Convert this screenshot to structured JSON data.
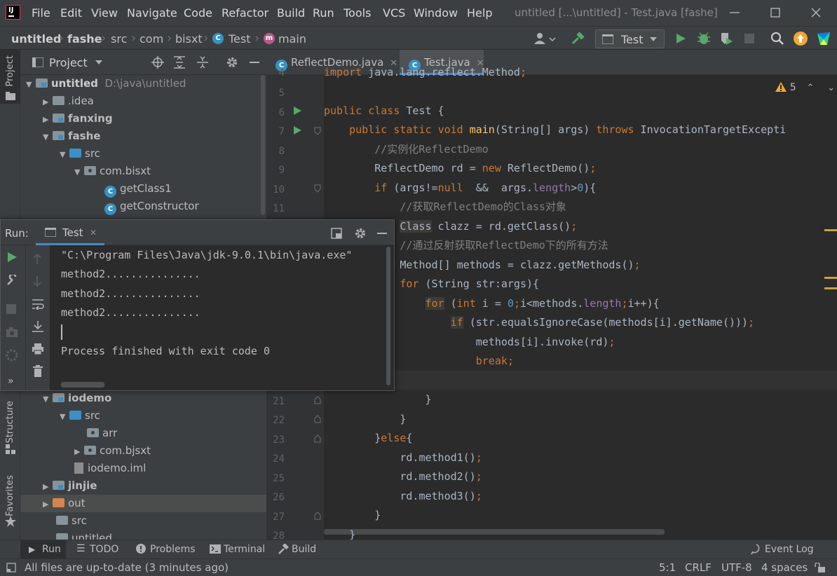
{
  "menubar": {
    "items": [
      "File",
      "Edit",
      "View",
      "Navigate",
      "Code",
      "Refactor",
      "Build",
      "Run",
      "Tools",
      "VCS",
      "Window",
      "Help"
    ],
    "window_title": "untitled [...\\untitled] - Test.java [fashe]"
  },
  "breadcrumb": {
    "items": [
      "untitled",
      "fashe",
      "src",
      "com",
      "bisxt",
      "Test",
      "main"
    ]
  },
  "run_config": {
    "label": "Test"
  },
  "side_labels": {
    "project": "Project",
    "structure": "Structure",
    "favorites": "Favorites"
  },
  "project_panel": {
    "title": "Project",
    "tree_top": [
      {
        "label": "untitled",
        "path": "D:\\java\\untitled"
      },
      {
        "label": ".idea"
      },
      {
        "label": "fanxing"
      },
      {
        "label": "fashe"
      },
      {
        "label": "src"
      },
      {
        "label": "com.bisxt"
      },
      {
        "label": "getClass1"
      },
      {
        "label": "getConstructor"
      }
    ],
    "tree_bottom": [
      {
        "label": "iodemo"
      },
      {
        "label": "src"
      },
      {
        "label": "arr"
      },
      {
        "label": "com.bjsxt"
      },
      {
        "label": "iodemo.iml"
      },
      {
        "label": "jinjie"
      },
      {
        "label": "out"
      },
      {
        "label": "src"
      },
      {
        "label": "untitled"
      }
    ]
  },
  "editor": {
    "tabs": [
      {
        "label": "ReflectDemo.java"
      },
      {
        "label": "Test.java"
      }
    ],
    "warnings": "5",
    "line_numbers": [
      "4",
      "5",
      "6",
      "7",
      "8",
      "9",
      "10",
      "11",
      "21",
      "22",
      "23",
      "24",
      "25",
      "26",
      "27",
      "28"
    ]
  },
  "code_lines": [
    "import java.lang.reflect.Method;",
    "",
    "public class Test {",
    "    public static void main(String[] args) throws InvocationTargetExcepti",
    "        //实例化ReflectDemo",
    "        ReflectDemo rd = new ReflectDemo();",
    "        if (args!=null  &&  args.length>0){",
    "            //获取ReflectDemo的Class对象",
    "            Class clazz = rd.getClass();",
    "            //通过反射获取ReflectDemo下的所有方法",
    "            Method[] methods = clazz.getMethods();",
    "            for (String str:args){",
    "                for (int i = 0;i<methods.length;i++){",
    "                    if (str.equalsIgnoreCase(methods[i].getName()));",
    "                        methods[i].invoke(rd);",
    "                        break;",
    "",
    "                }",
    "            }",
    "        }else{",
    "            rd.method1();",
    "            rd.method2();",
    "            rd.method3();",
    "        }",
    "    }"
  ],
  "run_panel": {
    "label": "Run:",
    "tab": "Test",
    "output": [
      "\"C:\\Program Files\\Java\\jdk-9.0.1\\bin\\java.exe\" ",
      "method2...............",
      "method2...............",
      "method2...............",
      "",
      "Process finished with exit code 0"
    ]
  },
  "bottom_tools": [
    "Run",
    "TODO",
    "Problems",
    "Terminal",
    "Build"
  ],
  "event_log": "Event Log",
  "status": {
    "message": "All files are up-to-date (3 minutes ago)",
    "position": "5:1",
    "line_sep": "CRLF",
    "encoding": "UTF-8",
    "indent": "4 spaces"
  },
  "colors": {
    "accent": "#3592c4",
    "keyword": "#cc7832",
    "function": "#ffc66d",
    "run_green": "#59a869"
  }
}
